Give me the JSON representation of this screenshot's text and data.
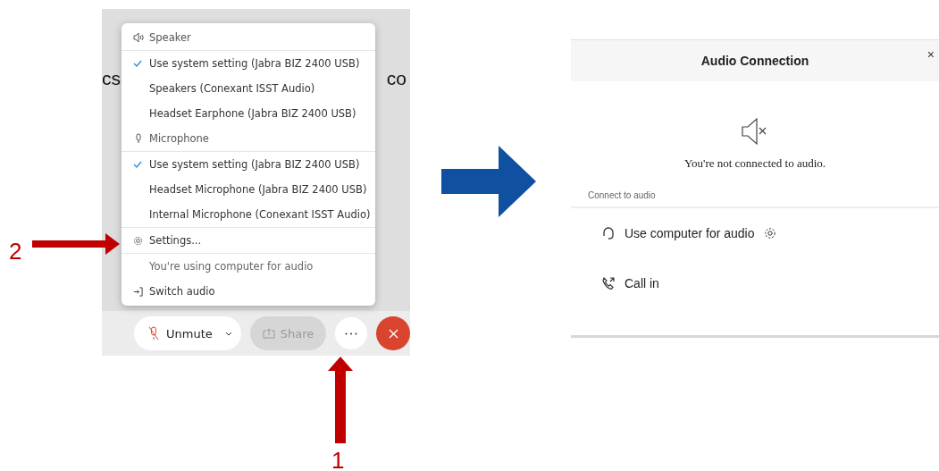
{
  "meeting_window": {
    "title_fragments": [
      "cs",
      "co"
    ],
    "audio_menu": {
      "sections": [
        {
          "kind": "speaker",
          "header": "Speaker",
          "options": [
            {
              "label": "Use system setting (Jabra BIZ 2400 USB)",
              "selected": true
            },
            {
              "label": "Speakers (Conexant ISST Audio)",
              "selected": false
            },
            {
              "label": "Headset Earphone (Jabra BIZ 2400 USB)",
              "selected": false
            }
          ]
        },
        {
          "kind": "microphone",
          "header": "Microphone",
          "options": [
            {
              "label": "Use system setting (Jabra BIZ 2400 USB)",
              "selected": true
            },
            {
              "label": "Headset Microphone (Jabra BIZ 2400 USB)",
              "selected": false
            },
            {
              "label": "Internal Microphone (Conexant ISST Audio)",
              "selected": false
            }
          ]
        }
      ],
      "settings": "Settings...",
      "status": "You're using computer for audio",
      "switch_audio": "Switch audio"
    },
    "toolbar": {
      "unmute": "Unmute",
      "share": {
        "label": "Share",
        "disabled": true
      }
    }
  },
  "annotations": [
    {
      "label": "2",
      "kind": "horizontal"
    },
    {
      "label": "1",
      "kind": "vertical"
    }
  ],
  "audio_dialog": {
    "title": "Audio Connection",
    "close": "×",
    "message": "You're not connected to audio.",
    "section_label": "Connect to audio",
    "options": [
      {
        "kind": "computer",
        "label": "Use computer for audio"
      },
      {
        "kind": "phone",
        "label": "Call in"
      }
    ]
  }
}
